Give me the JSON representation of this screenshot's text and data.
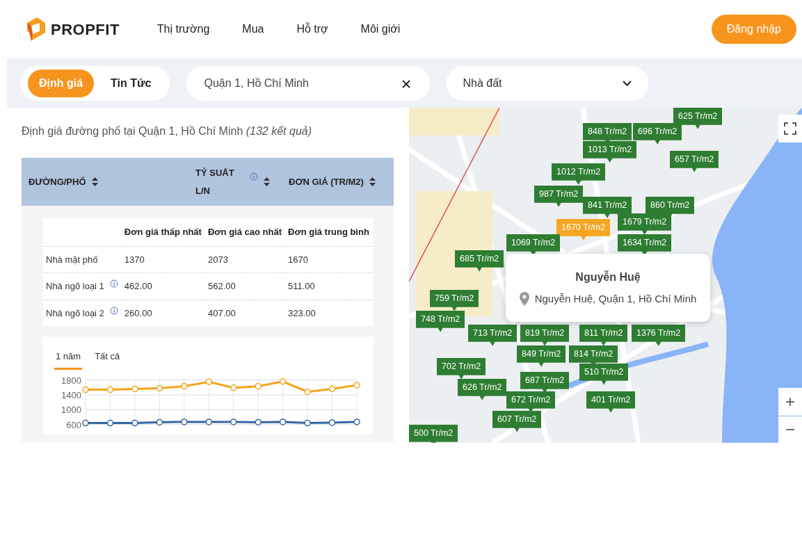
{
  "header": {
    "logo_text": "PROPFIT",
    "nav": [
      {
        "label": "Thị trường"
      },
      {
        "label": "Mua"
      },
      {
        "label": "Hỗ trợ"
      },
      {
        "label": "Môi giới"
      }
    ],
    "login_button": "Đăng nhập"
  },
  "filter_bar": {
    "tabs": [
      {
        "label": "Định giá",
        "selected": true
      },
      {
        "label": "Tin Tức",
        "selected": false
      }
    ],
    "search": {
      "value": "Quận 1, Hồ Chí Minh"
    },
    "type_dropdown": {
      "value": "Nhà đất"
    }
  },
  "results": {
    "title": "Định giá đường phố tại Quận 1, Hồ Chí Minh",
    "count": "(132 kết quả)",
    "table_columns": [
      {
        "label": "ĐƯỜNG/PHỐ",
        "info": false
      },
      {
        "label": "TỶ SUẤT L/N",
        "info": true
      },
      {
        "label": "ĐƠN GIÁ (TR/M2)",
        "info": false
      }
    ],
    "price_table": {
      "columns": [
        "Đơn giá thấp nhất",
        "Đơn giá cao nhất",
        "Đơn giá trung bình"
      ],
      "rows": [
        {
          "label": "Nhà mặt phố",
          "info": false,
          "values": [
            "1370",
            "2073",
            "1670"
          ]
        },
        {
          "label": "Nhà ngõ loại 1",
          "info": true,
          "values": [
            "462.00",
            "562.00",
            "511.00"
          ]
        },
        {
          "label": "Nhà ngõ loại 2",
          "info": true,
          "values": [
            "260.00",
            "407.00",
            "323.00"
          ]
        }
      ]
    },
    "chart_tabs": [
      {
        "label": "1 năm",
        "selected": true
      },
      {
        "label": "Tất cả",
        "selected": false
      }
    ],
    "chart_data": {
      "type": "line",
      "ylim": [
        500,
        1850
      ],
      "yticks": [
        600,
        1000,
        1400,
        1800
      ],
      "grid": true,
      "series": [
        {
          "color": "#f4a51c",
          "marker": true,
          "values": [
            1540,
            1540,
            1560,
            1580,
            1630,
            1750,
            1590,
            1630,
            1760,
            1480,
            1560,
            1660
          ]
        },
        {
          "color": "#3566a8",
          "marker": true,
          "values": [
            640,
            640,
            640,
            660,
            670,
            670,
            670,
            660,
            670,
            640,
            650,
            670
          ]
        }
      ]
    }
  },
  "map": {
    "markers": [
      {
        "label": "625 Tr/m2",
        "selected": false
      },
      {
        "label": "848 Tr/m2",
        "selected": false
      },
      {
        "label": "696 Tr/m2",
        "selected": false
      },
      {
        "label": "1013 Tr/m2",
        "selected": false
      },
      {
        "label": "657 Tr/m2",
        "selected": false
      },
      {
        "label": "1012 Tr/m2",
        "selected": false
      },
      {
        "label": "987 Tr/m2",
        "selected": false
      },
      {
        "label": "841 Tr/m2",
        "selected": false
      },
      {
        "label": "860 Tr/m2",
        "selected": false
      },
      {
        "label": "1679 Tr/m2",
        "selected": false
      },
      {
        "label": "1670 Tr/m2",
        "selected": true
      },
      {
        "label": "1634 Tr/m2",
        "selected": false
      },
      {
        "label": "1069 Tr/m2",
        "selected": false
      },
      {
        "label": "685 Tr/m2",
        "selected": false
      },
      {
        "label": "759 Tr/m2",
        "selected": false
      },
      {
        "label": "748 Tr/m2",
        "selected": false
      },
      {
        "label": "713 Tr/m2",
        "selected": false
      },
      {
        "label": "819 Tr/m2",
        "selected": false
      },
      {
        "label": "811 Tr/m2",
        "selected": false
      },
      {
        "label": "1376 Tr/m2",
        "selected": false
      },
      {
        "label": "849 Tr/m2",
        "selected": false
      },
      {
        "label": "814 Tr/m2",
        "selected": false
      },
      {
        "label": "702 Tr/m2",
        "selected": false
      },
      {
        "label": "510 Tr/m2",
        "selected": false
      },
      {
        "label": "687 Tr/m2",
        "selected": false
      },
      {
        "label": "626 Tr/m2",
        "selected": false
      },
      {
        "label": "672 Tr/m2",
        "selected": false
      },
      {
        "label": "401 Tr/m2",
        "selected": false
      },
      {
        "label": "607 Tr/m2",
        "selected": false
      },
      {
        "label": "500 Tr/m2",
        "selected": false
      }
    ],
    "popup": {
      "title": "Nguyễn Huệ",
      "address": "Nguyễn Huệ, Quận 1, Hồ Chí Minh"
    },
    "zoom_in": "+",
    "zoom_out": "−"
  }
}
